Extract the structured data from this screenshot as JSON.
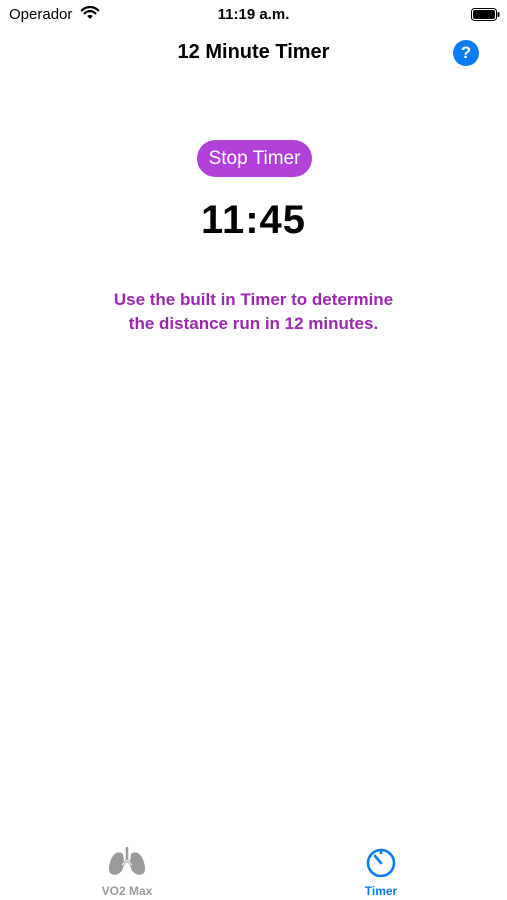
{
  "status_bar": {
    "carrier": "Operador",
    "time": "11:19 a.m."
  },
  "nav": {
    "title": "12 Minute Timer",
    "help_symbol": "?"
  },
  "timer": {
    "stop_label": "Stop Timer",
    "display": "11:45",
    "instructions_line1": "Use the built in Timer to determine",
    "instructions_line2": "the distance run in 12 minutes."
  },
  "tabs": [
    {
      "label": "VO2 Max",
      "icon": "lungs-icon",
      "selected": false
    },
    {
      "label": "Timer",
      "icon": "stopwatch-icon",
      "selected": true
    }
  ],
  "colors": {
    "accent_purple": "#b040d8",
    "instruction_purple": "#9c27b0",
    "tint_blue": "#0a7cf7",
    "inactive_gray": "#9a9a9a"
  }
}
